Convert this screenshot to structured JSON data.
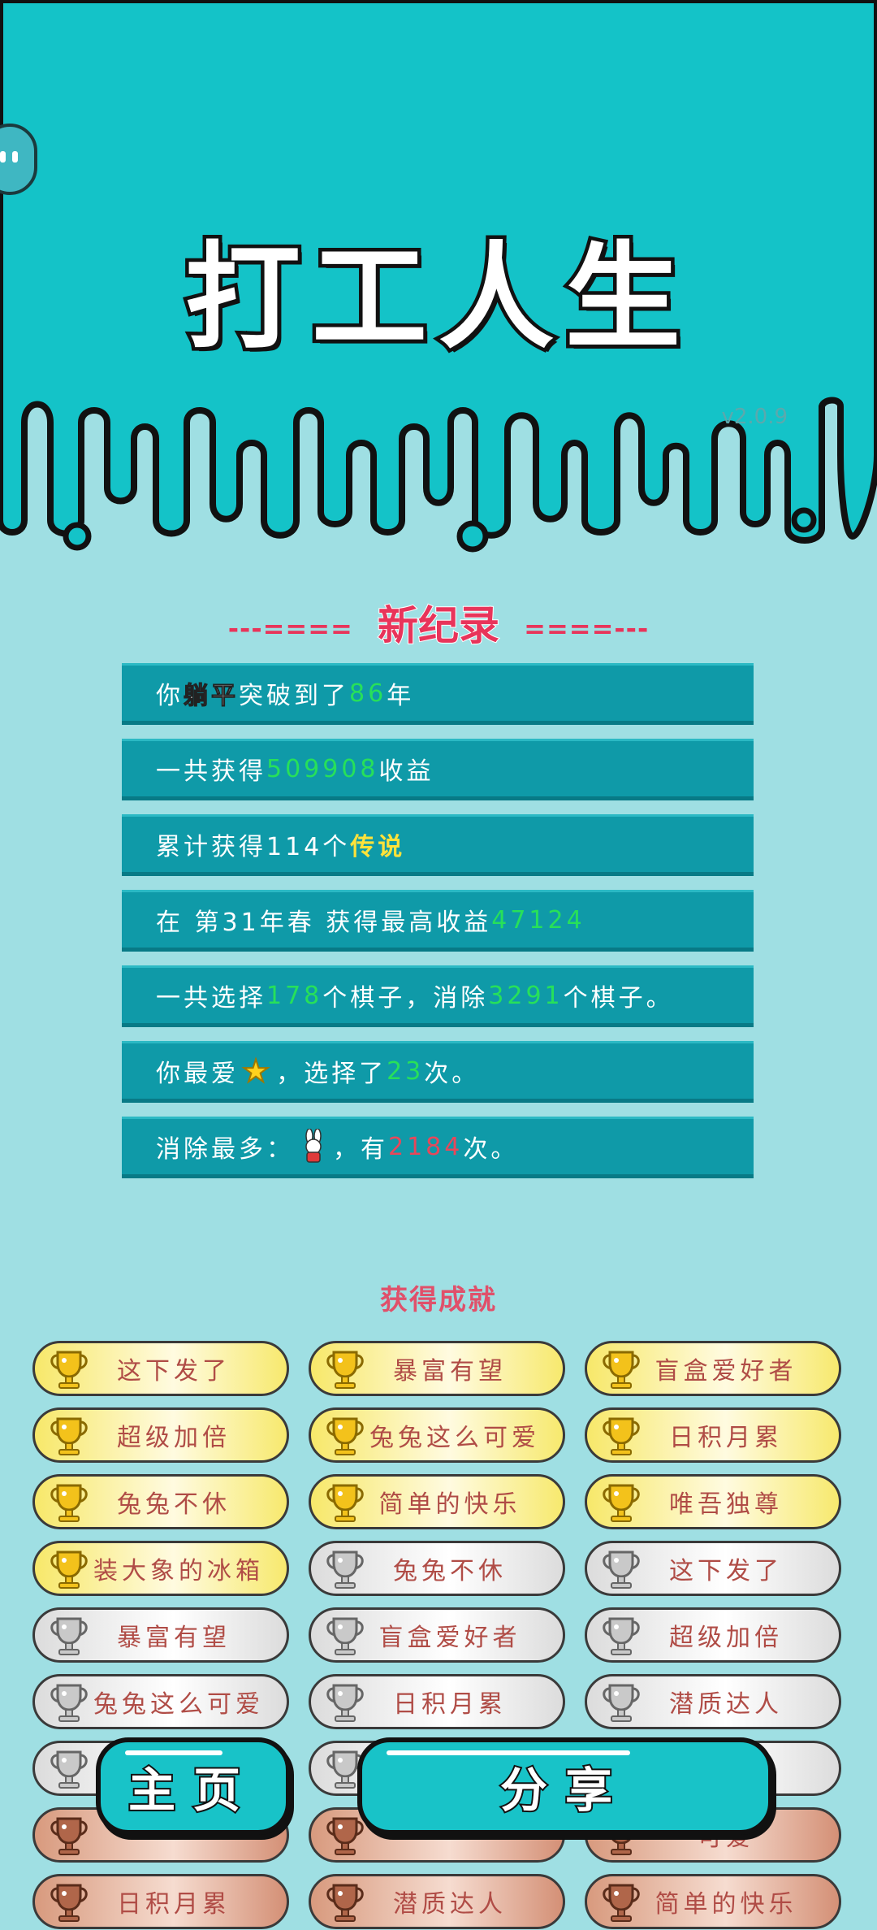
{
  "app": {
    "title": "打工人生",
    "version": "v2.0.9"
  },
  "record": {
    "header_left": "---==== ",
    "header_title": "新纪录",
    "header_right": " ====---",
    "stats": [
      {
        "a": "你",
        "b": "躺平",
        "c": "突破到了",
        "v": "86",
        "d": "年"
      },
      {
        "a": "一共获得",
        "v": "509908",
        "d": "收益"
      },
      {
        "a": "累计获得114个",
        "y": "传说"
      },
      {
        "a": "在 第31年春 获得最高收益",
        "v": "47124"
      },
      {
        "a": "一共选择",
        "v": "178",
        "b2": "个棋子，消除",
        "v2": "3291",
        "d": "个棋子。"
      },
      {
        "a": "你最爱",
        "b2": "，选择了",
        "v": "23",
        "d": "次。"
      },
      {
        "a": "消除最多：",
        "b2": "，有",
        "r": "2184",
        "d": "次。"
      }
    ]
  },
  "achievements": {
    "title": "获得成就",
    "items": [
      {
        "label": "这下发了",
        "tier": "gold"
      },
      {
        "label": "暴富有望",
        "tier": "gold"
      },
      {
        "label": "盲盒爱好者",
        "tier": "gold"
      },
      {
        "label": "超级加倍",
        "tier": "gold"
      },
      {
        "label": "兔兔这么可爱",
        "tier": "gold"
      },
      {
        "label": "日积月累",
        "tier": "gold"
      },
      {
        "label": "兔兔不休",
        "tier": "gold"
      },
      {
        "label": "简单的快乐",
        "tier": "gold"
      },
      {
        "label": "唯吾独尊",
        "tier": "gold"
      },
      {
        "label": "装大象的冰箱",
        "tier": "gold"
      },
      {
        "label": "兔兔不休",
        "tier": "silver"
      },
      {
        "label": "这下发了",
        "tier": "silver"
      },
      {
        "label": "暴富有望",
        "tier": "silver"
      },
      {
        "label": "盲盒爱好者",
        "tier": "silver"
      },
      {
        "label": "超级加倍",
        "tier": "silver"
      },
      {
        "label": "兔兔这么可爱",
        "tier": "silver"
      },
      {
        "label": "日积月累",
        "tier": "silver"
      },
      {
        "label": "潜质达人",
        "tier": "silver"
      },
      {
        "label": "",
        "tier": "silver"
      },
      {
        "label": "",
        "tier": "silver"
      },
      {
        "label": "冰箱",
        "tier": "silver"
      },
      {
        "label": "",
        "tier": "bronze"
      },
      {
        "label": "",
        "tier": "bronze"
      },
      {
        "label": "可爱",
        "tier": "bronze"
      },
      {
        "label": "日积月累",
        "tier": "bronze"
      },
      {
        "label": "潜质达人",
        "tier": "bronze"
      },
      {
        "label": "简单的快乐",
        "tier": "bronze"
      }
    ]
  },
  "buttons": {
    "home": "主页",
    "share": "分享"
  },
  "colors": {
    "header_bg": "#14c3c8",
    "page_bg": "#9fdfe3",
    "stat_bg": "#0f9aa8",
    "accent_red": "#e8345a",
    "value_green": "#27e05a",
    "legend_yellow": "#ffe23a"
  }
}
